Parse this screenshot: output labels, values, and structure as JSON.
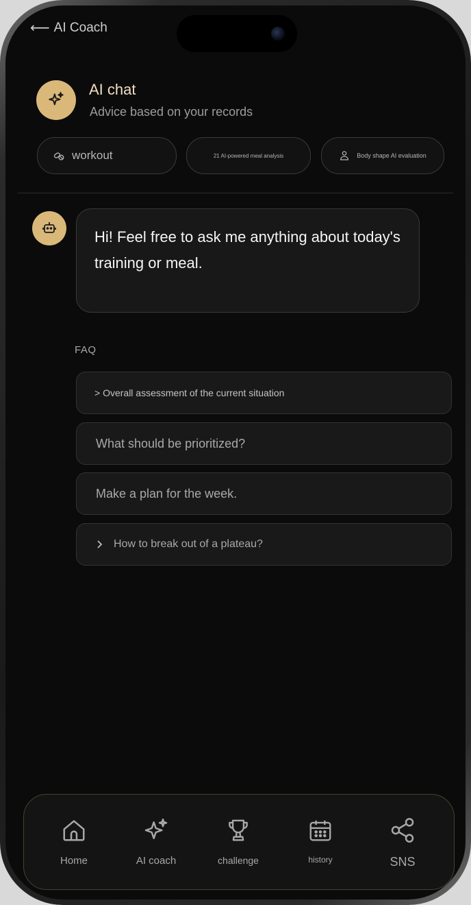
{
  "header": {
    "back_label": "AI Coach",
    "title": "AI chat",
    "subtitle": "Advice based on your records"
  },
  "chips": [
    {
      "label": "workout",
      "icon": "pill-icon"
    },
    {
      "label": "21 AI-powered meal analysis",
      "icon": ""
    },
    {
      "label": "Body shape AI evaluation",
      "icon": "person-icon"
    }
  ],
  "chat": {
    "message": "Hi! Feel free to ask me anything about today's training or meal."
  },
  "faq": {
    "label": "FAQ",
    "items": [
      "> Overall assessment of the current situation",
      "What should be prioritized?",
      "Make a plan for the week.",
      "How to break out of a plateau?"
    ]
  },
  "nav": {
    "items": [
      {
        "label": "Home",
        "icon": "home-icon"
      },
      {
        "label": "AI coach",
        "icon": "sparkle-icon"
      },
      {
        "label": "challenge",
        "icon": "trophy-icon"
      },
      {
        "label": "history",
        "icon": "calendar-icon"
      },
      {
        "label": "SNS",
        "icon": "share-icon"
      }
    ]
  },
  "colors": {
    "accent": "#d9b87a",
    "background": "#0b0b0b",
    "title": "#f0dcc0"
  }
}
